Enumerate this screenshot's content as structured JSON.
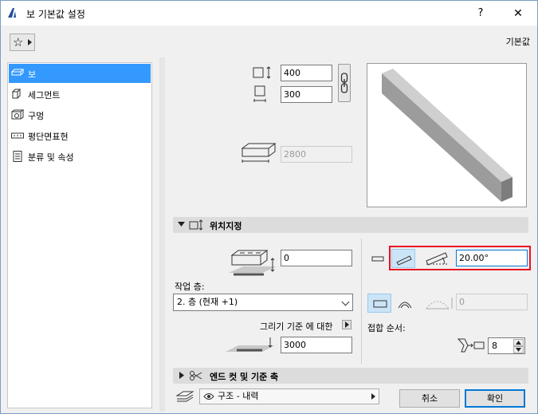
{
  "window": {
    "title": "보 기본값 설정",
    "help_label": "?",
    "close_label": "✕",
    "defaults_label": "기본값"
  },
  "sidebar": {
    "items": [
      {
        "label": "보",
        "icon": "beam-icon",
        "selected": true
      },
      {
        "label": "세그먼트",
        "icon": "segment-icon",
        "selected": false
      },
      {
        "label": "구멍",
        "icon": "hole-icon",
        "selected": false
      },
      {
        "label": "평단면표현",
        "icon": "floor-plan-icon",
        "selected": false
      },
      {
        "label": "분류 및 속성",
        "icon": "classification-icon",
        "selected": false
      }
    ]
  },
  "geometry": {
    "height_value": "400",
    "width_value": "300",
    "length_value": "2800"
  },
  "positioning": {
    "section_title": "위치지정",
    "offset_value": "0",
    "home_story_label": "작업 층:",
    "home_story_value": "2. 층 (현재 +1)",
    "reference_label": "그리기 기준 에 대한",
    "reference_value": "3000",
    "slant_angle_value": "20.00°",
    "arc_value": "0",
    "intersection_priority_label": "접합 순서:",
    "intersection_priority_value": "8"
  },
  "end_cuts": {
    "section_title": "엔드 컷 및 기준 축"
  },
  "footer": {
    "layer_value": "구조 - 내력",
    "cancel_label": "취소",
    "ok_label": "확인"
  },
  "colors": {
    "selection": "#3399ff",
    "highlight_box": "#e81123",
    "toggle_on": "#cce4f7"
  }
}
